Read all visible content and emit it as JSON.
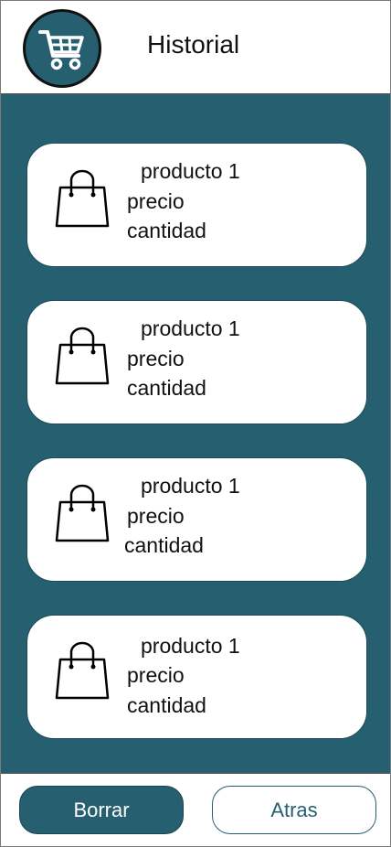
{
  "header": {
    "title": "Historial",
    "logo_icon": "shopping-cart-icon"
  },
  "history": {
    "items": [
      {
        "name": "producto 1",
        "price_label": "precio",
        "quantity_label": "cantidad",
        "icon": "shopping-bag-icon"
      },
      {
        "name": "producto 1",
        "price_label": "precio",
        "quantity_label": "cantidad",
        "icon": "shopping-bag-icon"
      },
      {
        "name": "producto 1",
        "price_label": "precio",
        "quantity_label": "cantidad",
        "icon": "shopping-bag-icon"
      },
      {
        "name": "producto 1",
        "price_label": "precio",
        "quantity_label": "cantidad",
        "icon": "shopping-bag-icon"
      }
    ]
  },
  "footer": {
    "clear_label": "Borrar",
    "back_label": "Atras"
  },
  "colors": {
    "primary": "#255f70",
    "surface": "#ffffff",
    "text": "#111111"
  }
}
